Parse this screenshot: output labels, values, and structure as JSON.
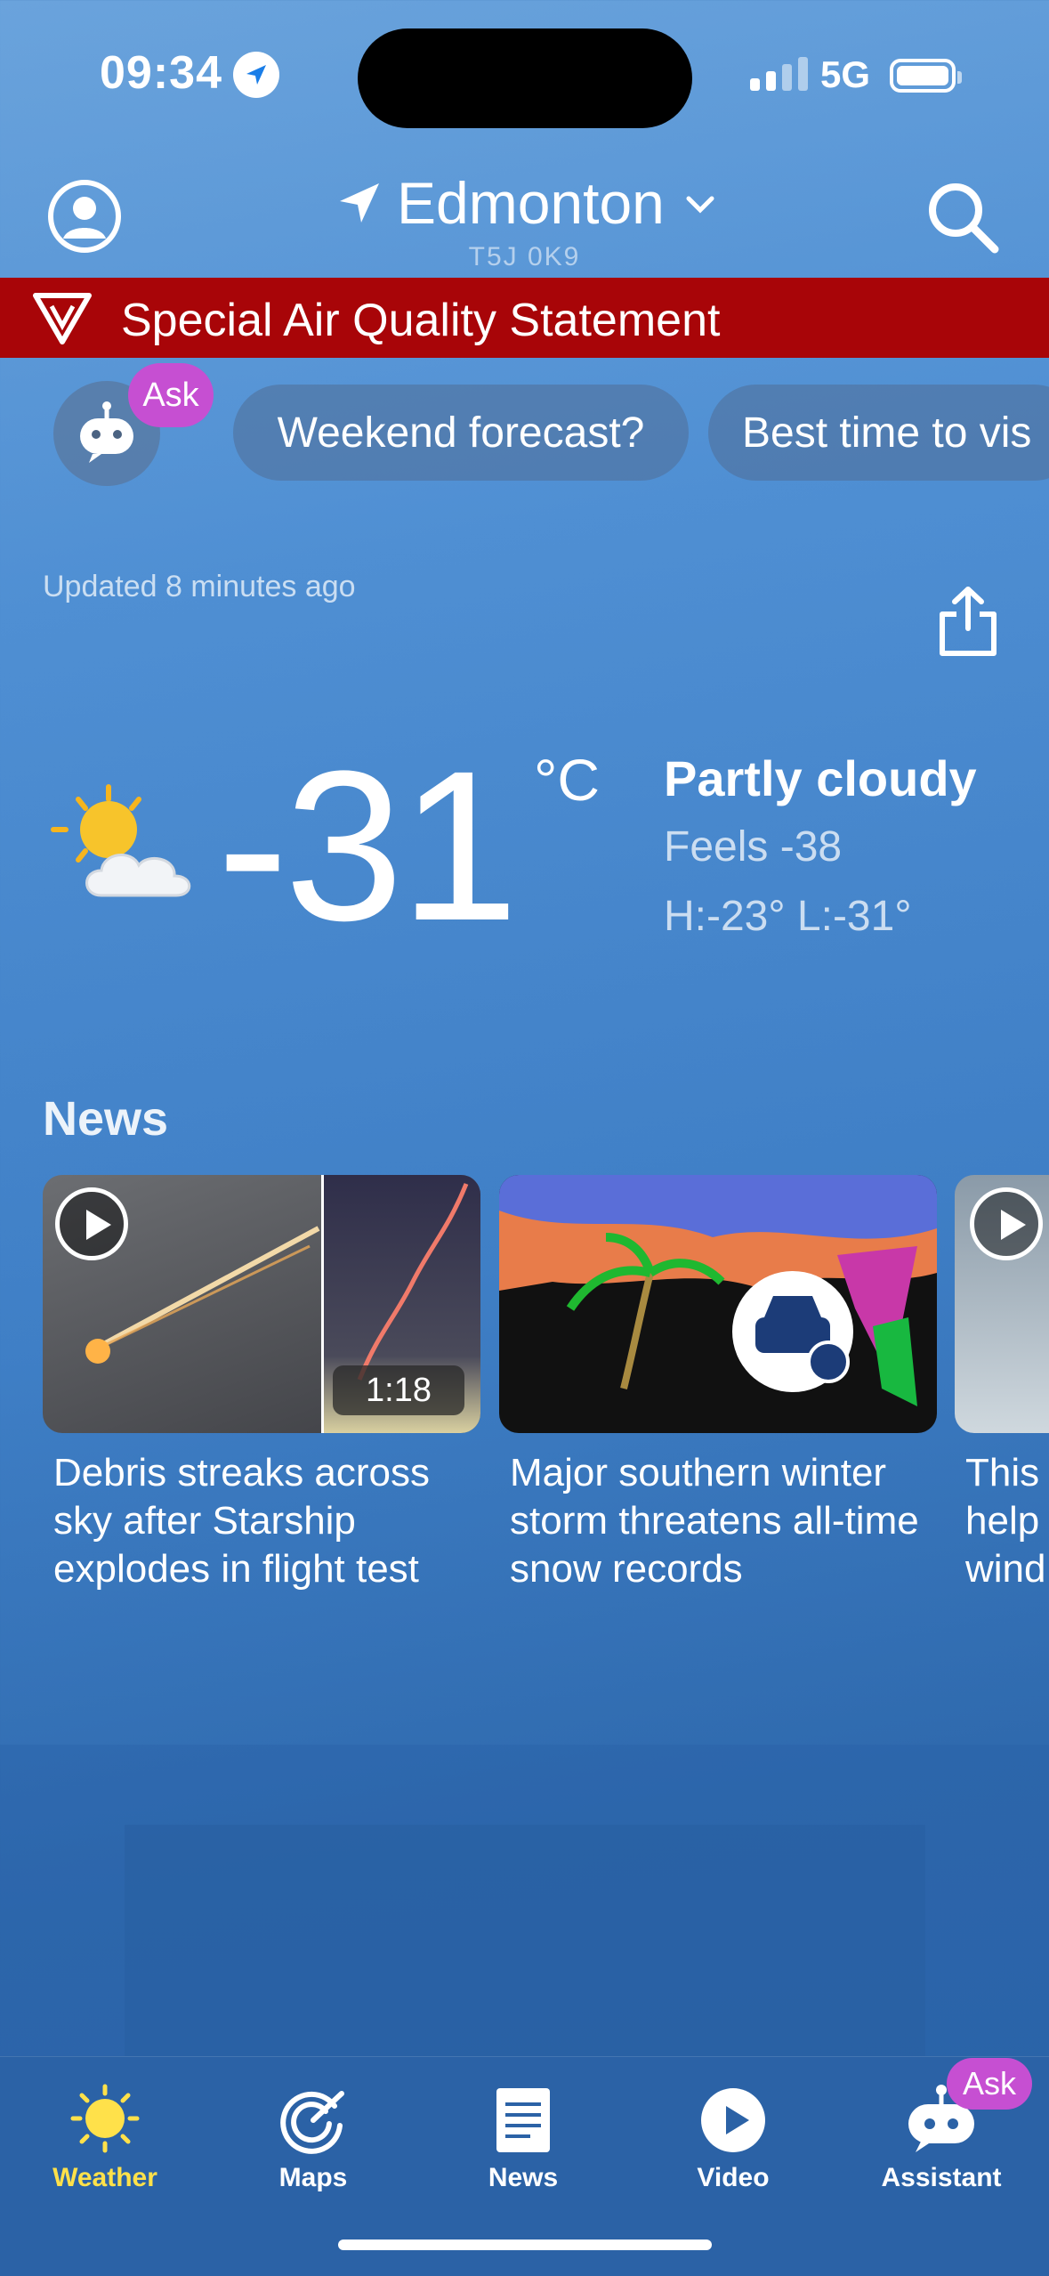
{
  "status_bar": {
    "time": "09:34",
    "network": "5G"
  },
  "header": {
    "city": "Edmonton",
    "postal_code": "T5J 0K9"
  },
  "alert": {
    "text": "Special Air Quality Statement",
    "color": "#a80508"
  },
  "assistant": {
    "badge": "Ask",
    "chips": [
      "Weekend forecast?",
      "Best time to vis"
    ]
  },
  "updated": "Updated 8 minutes ago",
  "current": {
    "temperature": "-31",
    "unit": "°C",
    "condition": "Partly cloudy",
    "feels_like": "Feels -38",
    "high_low": "H:-23° L:-31°",
    "icon": "partly-cloudy-icon"
  },
  "news": {
    "title": "News",
    "items": [
      {
        "headline": "Debris streaks across sky after Starship explodes in flight test",
        "duration": "1:18",
        "video": true
      },
      {
        "headline": "Major southern winter storm threatens all-time snow records",
        "video": false
      },
      {
        "headline": "This help wind",
        "video": true
      }
    ]
  },
  "tabbar": {
    "items": [
      "Weather",
      "Maps",
      "News",
      "Video",
      "Assistant"
    ],
    "active": "Weather",
    "ask_badge": "Ask",
    "active_color": "#ffe14a"
  }
}
